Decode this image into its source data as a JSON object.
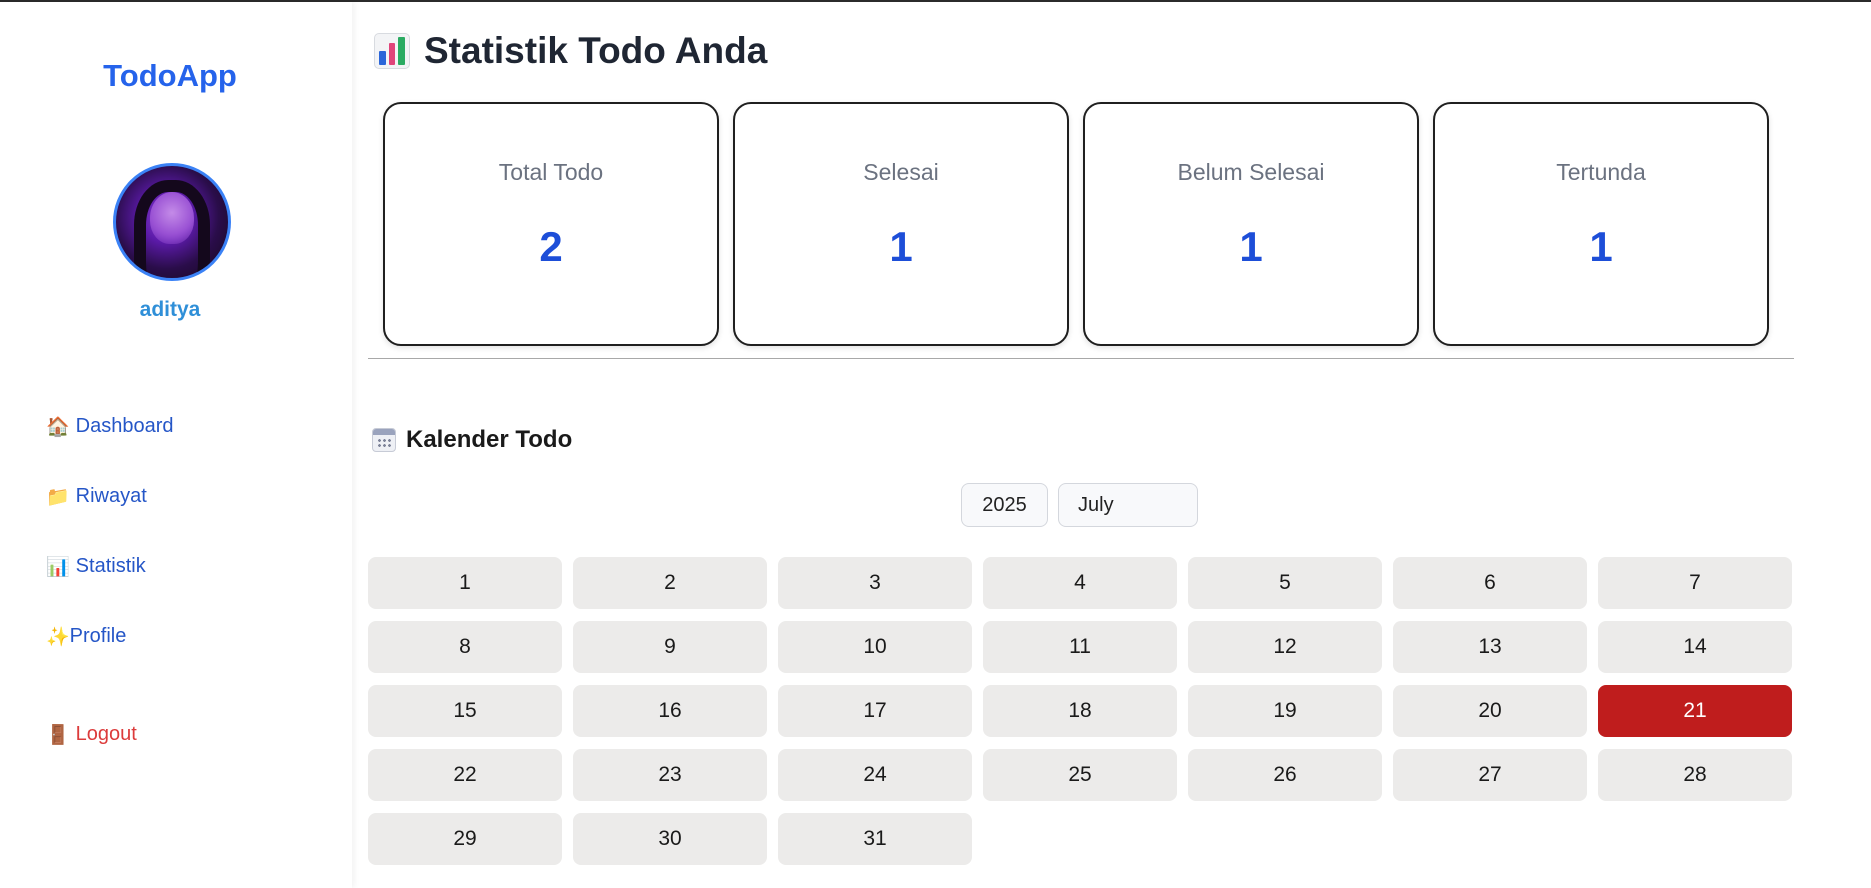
{
  "sidebar": {
    "brand": "TodoApp",
    "username": "aditya",
    "nav": [
      {
        "icon": "🏠",
        "icon_name": "house-icon",
        "label": "Dashboard"
      },
      {
        "icon": "📁",
        "icon_name": "folder-icon",
        "label": "Riwayat"
      },
      {
        "icon": "📊",
        "icon_name": "bar-chart-icon",
        "label": "Statistik"
      },
      {
        "icon": "✨",
        "icon_name": "sparkles-icon",
        "label": "Profile"
      }
    ],
    "logout": {
      "icon": "🚪",
      "icon_name": "door-icon",
      "label": "Logout"
    }
  },
  "main": {
    "title": "Statistik Todo Anda",
    "stats": [
      {
        "label": "Total Todo",
        "value": "2"
      },
      {
        "label": "Selesai",
        "value": "1"
      },
      {
        "label": "Belum Selesai",
        "value": "1"
      },
      {
        "label": "Tertunda",
        "value": "1"
      }
    ],
    "calendar": {
      "title": "Kalender Todo",
      "year": "2025",
      "month": "July",
      "highlighted_day": 21,
      "days": [
        "1",
        "2",
        "3",
        "4",
        "5",
        "6",
        "7",
        "8",
        "9",
        "10",
        "11",
        "12",
        "13",
        "14",
        "15",
        "16",
        "17",
        "18",
        "19",
        "20",
        "21",
        "22",
        "23",
        "24",
        "25",
        "26",
        "27",
        "28",
        "29",
        "30",
        "31"
      ]
    }
  },
  "colors": {
    "brand": "#2563eb",
    "stat_value": "#1d4ed8",
    "today": "#bf1d1d",
    "logout": "#dc3b3b"
  }
}
